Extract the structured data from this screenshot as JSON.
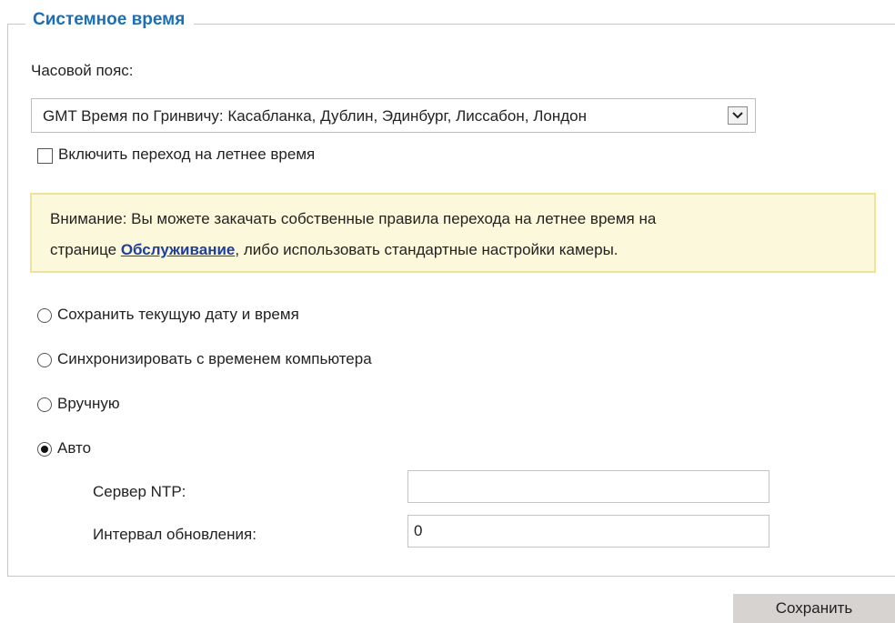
{
  "section": {
    "legend": "Системное время"
  },
  "timezone": {
    "label": "Часовой пояс:",
    "selected": "GMT Время по Гринвичу: Касабланка, Дублин, Эдинбург, Лиссабон, Лондон"
  },
  "dst": {
    "label": "Включить переход на летнее время",
    "checked": false
  },
  "notice": {
    "line1": "Внимание: Вы можете закачать собственные правила перехода на летнее время на",
    "line2_prefix": "странице ",
    "link": "Обслуживание",
    "line2_suffix": ", либо использовать стандартные настройки камеры."
  },
  "modes": [
    {
      "label": "Сохранить текущую дату и время",
      "selected": false
    },
    {
      "label": "Синхронизировать с временем компьютера",
      "selected": false
    },
    {
      "label": "Вручную",
      "selected": false
    },
    {
      "label": "Авто",
      "selected": true
    }
  ],
  "ntp": {
    "label": "Сервер NTP:",
    "value": ""
  },
  "interval": {
    "label": "Интервал обновления:",
    "value": "0"
  },
  "save_label": "Сохранить",
  "colors": {
    "legend": "#1a6fb5",
    "notice_bg": "#fcf8db",
    "link": "#1d3f9e",
    "button_bg": "#d6d3d0"
  }
}
